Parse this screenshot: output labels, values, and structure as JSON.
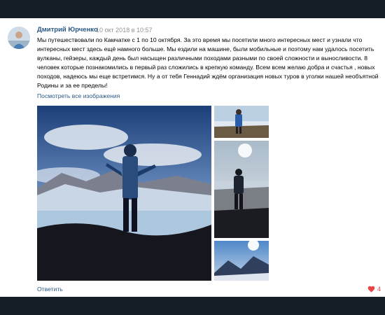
{
  "post": {
    "author_name": "Дмитрий Юрченко",
    "date": "10 окт 2018 в 10:57",
    "text": "Мы путешествовали по Камчатке с 1 по 10 октября. За это время мы посетили много интересных мест и узнали что интересных мест здесь ещё намного больше. Мы ездили на машине, были мобильные и поэтому нам удалось посетить вулканы, гейзеры, каждый день был насыщен различными походами разными по своей сложности и выносливости. 8 человек которые познакомились в первый раз сложились в крепкую команду. Всем всем желаю добра и счастья , новых походов, надеюсь мы еще встретимся. Ну а от тебя Геннадий ждём организация новых туров в уголки нашей необъятной Родины и за ее пределы!",
    "see_all_images": "Посмотреть все изображения",
    "reply_label": "Ответить",
    "likes_count": "4"
  },
  "colors": {
    "link": "#2a5885",
    "like": "#e64646",
    "frame": "#141d25"
  },
  "icons": {
    "like": "heart-icon"
  }
}
